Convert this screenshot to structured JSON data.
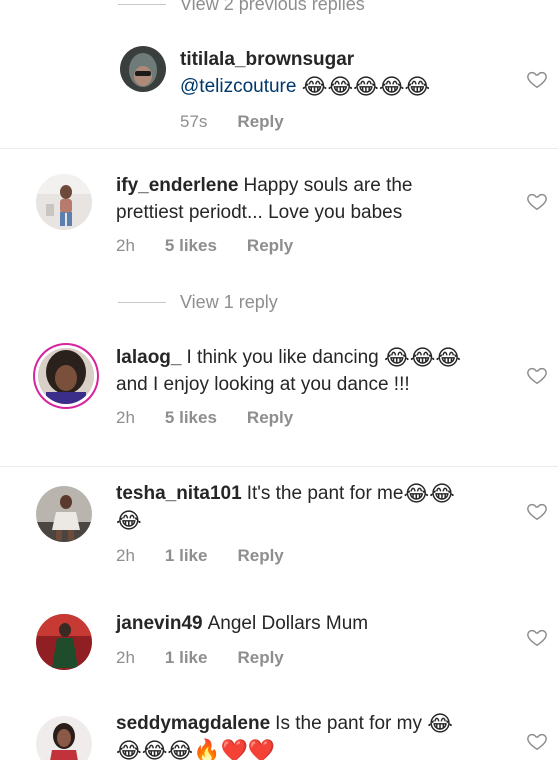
{
  "top_view": {
    "label": "View 2 previous replies"
  },
  "mid_view": {
    "label": "View 1 reply"
  },
  "comments": [
    {
      "username": "titilala_brownsugar",
      "mention": "@telizcouture",
      "text": "",
      "emoji_after": "😂😂😂😂😂",
      "time": "57s",
      "likes": "",
      "reply": "Reply"
    },
    {
      "username": "ify_enderlene",
      "text": "Happy souls are the prettiest periodt... Love you babes",
      "time": "2h",
      "likes": "5 likes",
      "reply": "Reply"
    },
    {
      "username": "lalaog_",
      "text_line1": "I think you like dancing",
      "emoji_line1": "😂😂😂",
      "text_line2": "and I enjoy looking at you dance !!!",
      "time": "2h",
      "likes": "5 likes",
      "reply": "Reply"
    },
    {
      "username": "tesha_nita101",
      "text": "It's the pant for me",
      "emoji_after": "😂😂",
      "emoji_line2": "😂",
      "time": "2h",
      "likes": "1 like",
      "reply": "Reply"
    },
    {
      "username": "janevin49",
      "text": "Angel Dollars Mum",
      "time": "2h",
      "likes": "1 like",
      "reply": "Reply"
    },
    {
      "username": "seddymagdalene",
      "text": "Is the pant for my",
      "emoji_after": "😂",
      "emoji_line2": "😂😂😂🔥❤️❤️"
    }
  ],
  "icons": {
    "heart": "heart-outline-icon",
    "avatar": "user-avatar"
  },
  "colors": {
    "text": "#262626",
    "muted": "#8e8e8e",
    "mention": "#00376b",
    "story_ring": "#d6249f"
  }
}
